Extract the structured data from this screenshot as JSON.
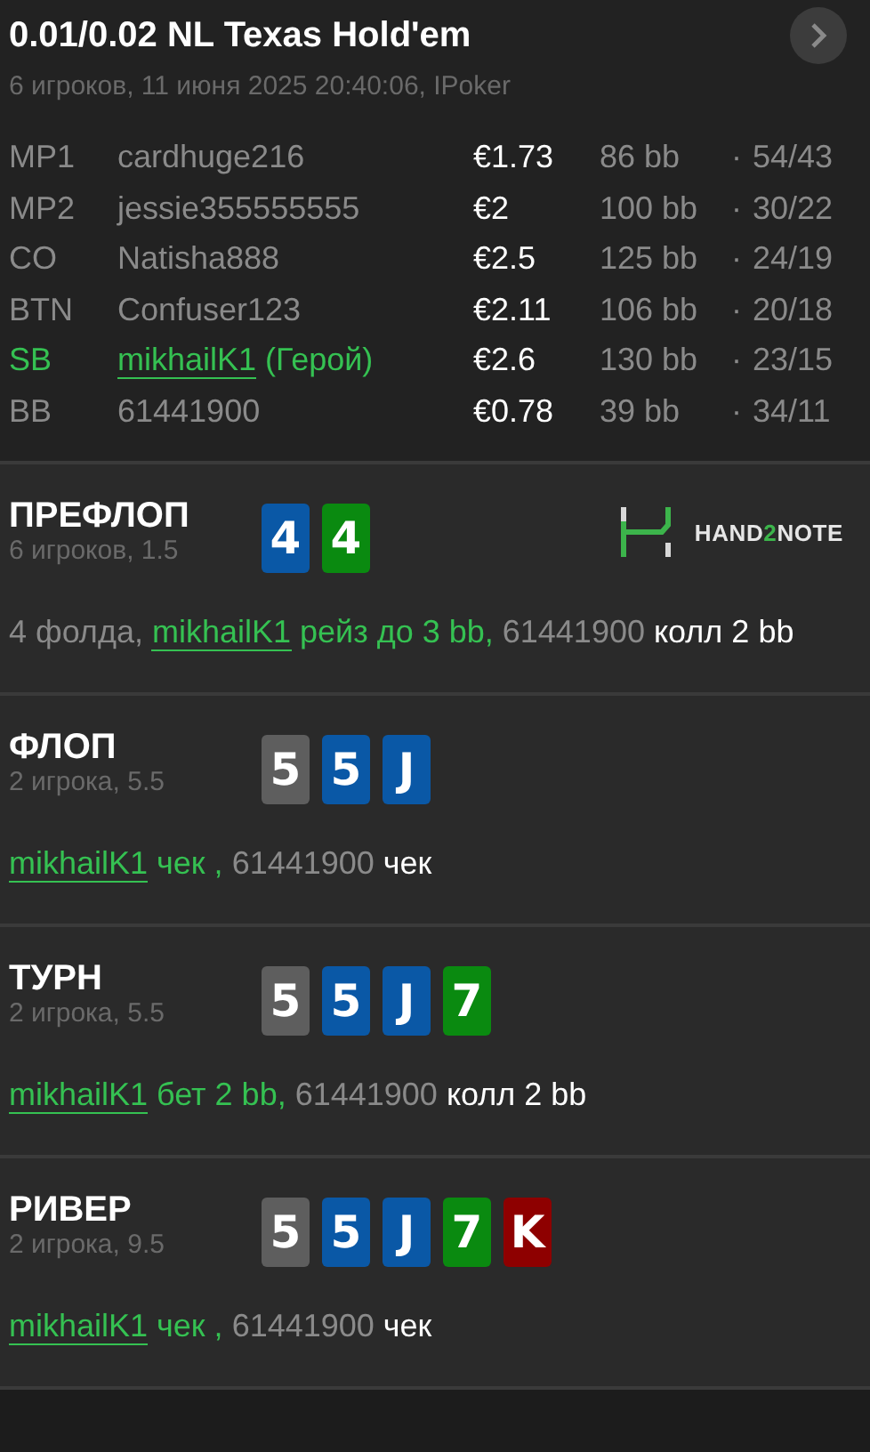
{
  "header": {
    "title": "0.01/0.02 NL Texas Hold'em",
    "subtitle": "6 игроков, 11 июня 2025 20:40:06, IPoker"
  },
  "players": [
    {
      "position": "MP1",
      "name": "cardhuge216",
      "hero": false,
      "stack": "€1.73",
      "bb": "86 bb",
      "dot": "·",
      "stats": "54/43"
    },
    {
      "position": "MP2",
      "name": "jessie355555555",
      "hero": false,
      "stack": "€2",
      "bb": "100 bb",
      "dot": "·",
      "stats": "30/22"
    },
    {
      "position": "CO",
      "name": "Natisha888",
      "hero": false,
      "stack": "€2.5",
      "bb": "125 bb",
      "dot": "·",
      "stats": "24/19"
    },
    {
      "position": "BTN",
      "name": "Confuser123",
      "hero": false,
      "stack": "€2.11",
      "bb": "106 bb",
      "dot": "·",
      "stats": "20/18"
    },
    {
      "position": "SB",
      "name": "mikhailK1",
      "hero": true,
      "hero_tag": "(Герой)",
      "stack": "€2.6",
      "bb": "130 bb",
      "dot": "·",
      "stats": "23/15"
    },
    {
      "position": "BB",
      "name": "61441900",
      "hero": false,
      "stack": "€0.78",
      "bb": "39 bb",
      "dot": "·",
      "stats": "34/11"
    }
  ],
  "streets": [
    {
      "title": "ПРЕФЛОП",
      "subtitle": "6 игроков, 1.5",
      "cards": [
        {
          "rank": "4",
          "color": "#0a58a6"
        },
        {
          "rank": "4",
          "color": "#0a8a10"
        }
      ],
      "logo": {
        "before": "HAND",
        "accent": "2",
        "after": "NOTE"
      },
      "actions": [
        {
          "kind": "muted",
          "text": "4 фолда, "
        },
        {
          "kind": "hero",
          "text": "mikhailK1"
        },
        {
          "kind": "hero_action",
          "text": " рейз до 3 bb, "
        },
        {
          "kind": "muted",
          "text": "61441900 "
        },
        {
          "kind": "action",
          "text": "колл 2 bb"
        }
      ]
    },
    {
      "title": "ФЛОП",
      "subtitle": "2 игрока, 5.5",
      "cards": [
        {
          "rank": "5",
          "color": "#5e5e5e"
        },
        {
          "rank": "5",
          "color": "#0a58a6"
        },
        {
          "rank": "J",
          "color": "#0a58a6"
        }
      ],
      "actions": [
        {
          "kind": "hero",
          "text": "mikhailK1"
        },
        {
          "kind": "hero_action",
          "text": " чек , "
        },
        {
          "kind": "muted",
          "text": "61441900 "
        },
        {
          "kind": "action",
          "text": "чек"
        }
      ]
    },
    {
      "title": "ТУРН",
      "subtitle": "2 игрока, 5.5",
      "cards": [
        {
          "rank": "5",
          "color": "#5e5e5e"
        },
        {
          "rank": "5",
          "color": "#0a58a6"
        },
        {
          "rank": "J",
          "color": "#0a58a6"
        },
        {
          "rank": "7",
          "color": "#0a8a10"
        }
      ],
      "actions": [
        {
          "kind": "hero",
          "text": "mikhailK1"
        },
        {
          "kind": "hero_action",
          "text": " бет 2 bb, "
        },
        {
          "kind": "muted",
          "text": "61441900 "
        },
        {
          "kind": "action",
          "text": "колл 2 bb"
        }
      ]
    },
    {
      "title": "РИВЕР",
      "subtitle": "2 игрока, 9.5",
      "cards": [
        {
          "rank": "5",
          "color": "#5e5e5e"
        },
        {
          "rank": "5",
          "color": "#0a58a6"
        },
        {
          "rank": "J",
          "color": "#0a58a6"
        },
        {
          "rank": "7",
          "color": "#0a8a10"
        },
        {
          "rank": "K",
          "color": "#8e0000"
        }
      ],
      "actions": [
        {
          "kind": "hero",
          "text": "mikhailK1"
        },
        {
          "kind": "hero_action",
          "text": " чек , "
        },
        {
          "kind": "muted",
          "text": "61441900 "
        },
        {
          "kind": "action",
          "text": "чек"
        }
      ]
    }
  ]
}
